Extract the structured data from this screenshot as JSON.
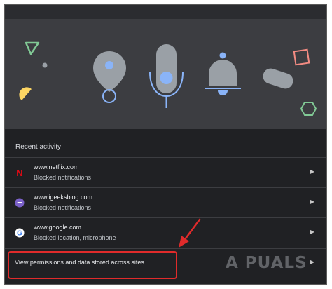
{
  "section_title": "Recent activity",
  "recent_activity": [
    {
      "site": "www.netflix.com",
      "status": "Blocked notifications",
      "icon": "netflix-favicon",
      "icon_letter": "N",
      "icon_color": "#e50914"
    },
    {
      "site": "www.igeeksblog.com",
      "status": "Blocked notifications",
      "icon": "igeeksblog-favicon",
      "icon_letter": "",
      "icon_color": "#7b61c9"
    },
    {
      "site": "www.google.com",
      "status": "Blocked location, microphone",
      "icon": "google-favicon",
      "icon_letter": "G",
      "icon_color": "#4285f4"
    }
  ],
  "permissions_link": {
    "label": "View permissions and data stored across sites"
  },
  "watermark": "A  PUALS",
  "colors": {
    "background": "#202124",
    "hero_background": "#3c3d41",
    "accent_blue": "#8ab4f8",
    "icon_gray": "#9aa0a6",
    "highlight_red": "#e02b2b",
    "shape_yellow": "#fdd663",
    "shape_green": "#81c995",
    "shape_pink": "#f28b82"
  }
}
